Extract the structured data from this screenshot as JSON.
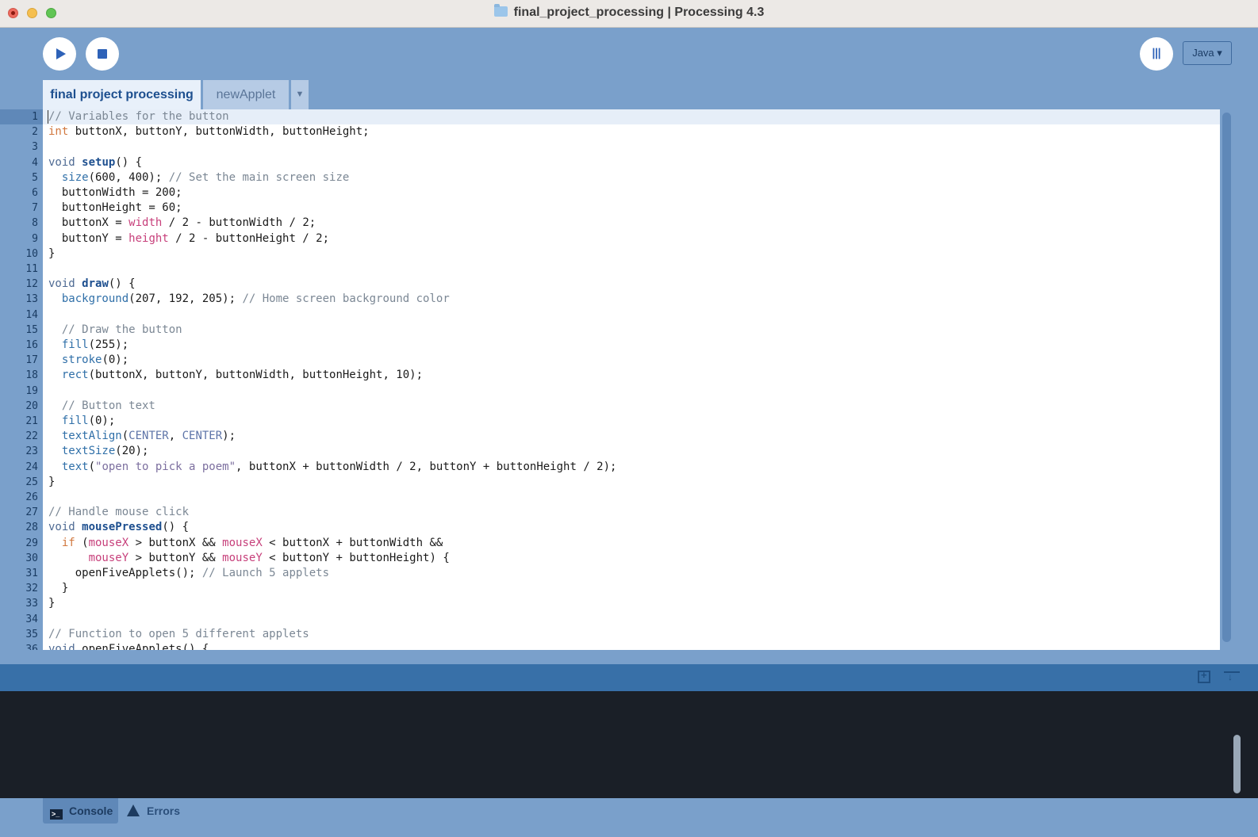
{
  "window": {
    "title": "final_project_processing | Processing 4.3"
  },
  "toolbar": {
    "run_icon": "play-icon",
    "stop_icon": "stop-icon",
    "debug_label": "ꔖ",
    "mode_label": "Java ▾"
  },
  "tabs": [
    {
      "label": "final project processing",
      "active": true
    },
    {
      "label": "newApplet",
      "active": false
    }
  ],
  "tab_menu_label": "▼",
  "editor": {
    "current_line": 1,
    "lines": [
      {
        "num": "1"
      },
      {
        "num": "2"
      },
      {
        "num": "3"
      },
      {
        "num": "4"
      },
      {
        "num": "5"
      },
      {
        "num": "6"
      },
      {
        "num": "7"
      },
      {
        "num": "8"
      },
      {
        "num": "9"
      },
      {
        "num": "10"
      },
      {
        "num": "11"
      },
      {
        "num": "12"
      },
      {
        "num": "13"
      },
      {
        "num": "14"
      },
      {
        "num": "15"
      },
      {
        "num": "16"
      },
      {
        "num": "17"
      },
      {
        "num": "18"
      },
      {
        "num": "19"
      },
      {
        "num": "20"
      },
      {
        "num": "21"
      },
      {
        "num": "22"
      },
      {
        "num": "23"
      },
      {
        "num": "24"
      },
      {
        "num": "25"
      },
      {
        "num": "26"
      },
      {
        "num": "27"
      },
      {
        "num": "28"
      },
      {
        "num": "29"
      },
      {
        "num": "30"
      },
      {
        "num": "31"
      },
      {
        "num": "32"
      },
      {
        "num": "33"
      },
      {
        "num": "34"
      },
      {
        "num": "35"
      },
      {
        "num": "36"
      }
    ],
    "code": {
      "l1": "// Variables for the button",
      "l2_type": "int",
      "l2_rest": " buttonX, buttonY, buttonWidth, buttonHeight;",
      "l4_void": "void",
      "l4_name": "setup",
      "l4_rest": "() {",
      "l5_fn": "size",
      "l5_args": "(600, 400); ",
      "l5_cm": "// Set the main screen size",
      "l6": "  buttonWidth = 200;",
      "l7": "  buttonHeight = 60;",
      "l8_a": "  buttonX = ",
      "l8_var": "width",
      "l8_b": " / 2 - buttonWidth / 2;",
      "l9_a": "  buttonY = ",
      "l9_var": "height",
      "l9_b": " / 2 - buttonHeight / 2;",
      "l10": "}",
      "l12_void": "void",
      "l12_name": "draw",
      "l12_rest": "() {",
      "l13_fn": "background",
      "l13_args": "(207, 192, 205); ",
      "l13_cm": "// Home screen background color",
      "l15_cm": "// Draw the button",
      "l16_fn": "fill",
      "l16_args": "(255);",
      "l17_fn": "stroke",
      "l17_args": "(0);",
      "l18_fn": "rect",
      "l18_args": "(buttonX, buttonY, buttonWidth, buttonHeight, 10);",
      "l20_cm": "// Button text",
      "l21_fn": "fill",
      "l21_args": "(0);",
      "l22_fn": "textAlign",
      "l22_open": "(",
      "l22_c1": "CENTER",
      "l22_sep": ", ",
      "l22_c2": "CENTER",
      "l22_close": ");",
      "l23_fn": "textSize",
      "l23_args": "(20);",
      "l24_fn": "text",
      "l24_open": "(",
      "l24_str": "\"open to pick a poem\"",
      "l24_rest": ", buttonX + buttonWidth / 2, buttonY + buttonHeight / 2);",
      "l25": "}",
      "l27_cm": "// Handle mouse click",
      "l28_void": "void",
      "l28_name": "mousePressed",
      "l28_rest": "() {",
      "l29_if": "if",
      "l29_a": " (",
      "l29_mx1": "mouseX",
      "l29_b": " > buttonX && ",
      "l29_mx2": "mouseX",
      "l29_c": " < buttonX + buttonWidth &&",
      "l30_my1": "mouseY",
      "l30_b": " > buttonY && ",
      "l30_my2": "mouseY",
      "l30_c": " < buttonY + buttonHeight) {",
      "l31_a": "    openFiveApplets(); ",
      "l31_cm": "// Launch 5 applets",
      "l32": "  }",
      "l33": "}",
      "l35_cm": "// Function to open 5 different applets",
      "l36_void": "void",
      "l36_rest": " openFiveApplets() {"
    }
  },
  "footer": {
    "console_label": "Console",
    "errors_label": "Errors"
  },
  "colors": {
    "chrome_blue": "#7aa0cb",
    "console_header": "#3870a8",
    "console_bg": "#1a1f27"
  }
}
